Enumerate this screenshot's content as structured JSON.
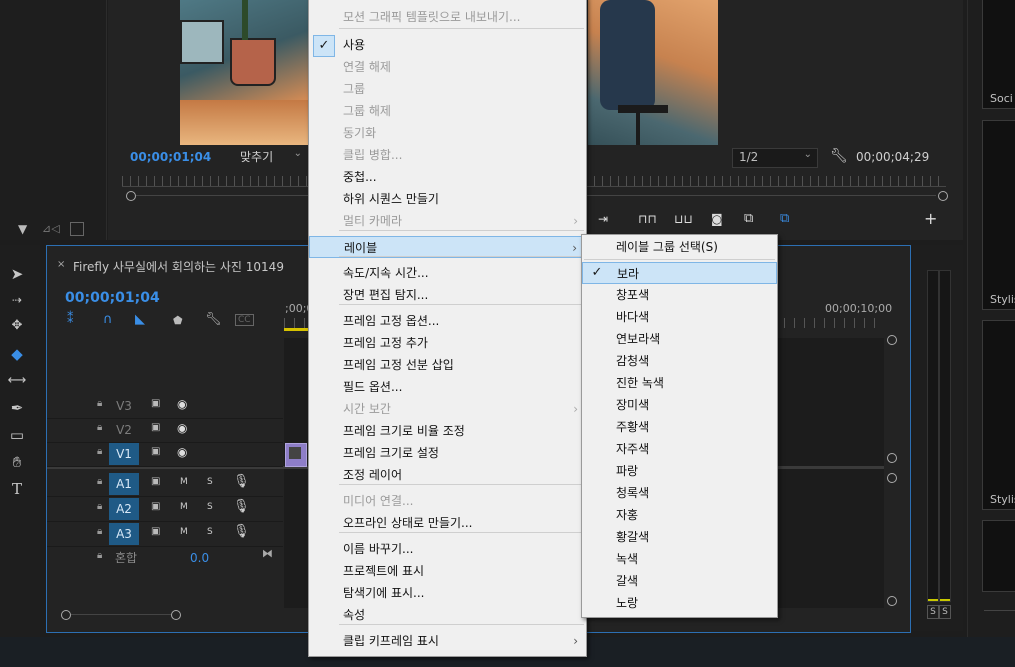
{
  "program_monitor": {
    "timecode_current": "00;00;01;04",
    "fit_label": "맞추기",
    "resolution": "1/2",
    "timecode_duration": "00;00;04;29"
  },
  "right_panel": {
    "item1_label": "Soci",
    "item2_label": "Stylis",
    "item3_label": "Stylis"
  },
  "timeline": {
    "tab_title": "Firefly 사무실에서 회의하는 사진 10149",
    "timecode": "00;00;01;04",
    "ruler_start": ";00;0",
    "ruler_end": "00;00;10;00",
    "tracks": [
      {
        "name": "V3",
        "kind": "video"
      },
      {
        "name": "V2",
        "kind": "video"
      },
      {
        "name": "V1",
        "kind": "video"
      },
      {
        "name": "A1",
        "kind": "audio"
      },
      {
        "name": "A2",
        "kind": "audio"
      },
      {
        "name": "A3",
        "kind": "audio"
      }
    ],
    "mix_label": "혼합",
    "mix_value": "0.0",
    "m_label": "M",
    "s_label": "S"
  },
  "audio_meter": {
    "s1": "S",
    "s2": "S"
  },
  "context_menu": {
    "items": [
      {
        "label": "모션 그래픽 템플릿으로 내보내기...",
        "disabled": true
      },
      {
        "label": "사용",
        "checked": true
      },
      {
        "label": "연결 해제",
        "disabled": true
      },
      {
        "label": "그룹",
        "disabled": true
      },
      {
        "label": "그룹 해제",
        "disabled": true
      },
      {
        "label": "동기화",
        "disabled": true
      },
      {
        "label": "클립 병합...",
        "disabled": true
      },
      {
        "label": "중첩..."
      },
      {
        "label": "하위 시퀀스 만들기"
      },
      {
        "label": "멀티 카메라",
        "disabled": true,
        "submenu": true
      },
      {
        "label": "레이블",
        "submenu": true,
        "highlighted": true
      },
      {
        "label": "속도/지속 시간..."
      },
      {
        "label": "장면 편집 탐지..."
      },
      {
        "label": "프레임 고정 옵션..."
      },
      {
        "label": "프레임 고정 추가"
      },
      {
        "label": "프레임 고정 선분 삽입"
      },
      {
        "label": "필드 옵션..."
      },
      {
        "label": "시간 보간",
        "disabled": true,
        "submenu": true
      },
      {
        "label": "프레임 크기로 비율 조정"
      },
      {
        "label": "프레임 크기로 설정"
      },
      {
        "label": "조정 레이어"
      },
      {
        "label": "미디어 연결...",
        "disabled": true
      },
      {
        "label": "오프라인 상태로 만들기..."
      },
      {
        "label": "이름 바꾸기..."
      },
      {
        "label": "프로젝트에 표시"
      },
      {
        "label": "탐색기에 표시..."
      },
      {
        "label": "속성"
      },
      {
        "label": "클립 키프레임 표시",
        "submenu": true
      }
    ]
  },
  "label_submenu": {
    "items": [
      {
        "label": "레이블 그룹 선택(S)"
      },
      {
        "label": "보라",
        "checked": true
      },
      {
        "label": "창포색"
      },
      {
        "label": "바다색"
      },
      {
        "label": "연보라색"
      },
      {
        "label": "감청색"
      },
      {
        "label": "진한 녹색"
      },
      {
        "label": "장미색"
      },
      {
        "label": "주황색"
      },
      {
        "label": "자주색"
      },
      {
        "label": "파랑"
      },
      {
        "label": "청록색"
      },
      {
        "label": "자홍"
      },
      {
        "label": "황갈색"
      },
      {
        "label": "녹색"
      },
      {
        "label": "갈색"
      },
      {
        "label": "노랑"
      }
    ]
  },
  "colors": {
    "accent": "#3a8ee6",
    "track_selected": "#1f5a86",
    "menu_bg": "#f0f0f0",
    "menu_highlight": "#cce4f7"
  }
}
